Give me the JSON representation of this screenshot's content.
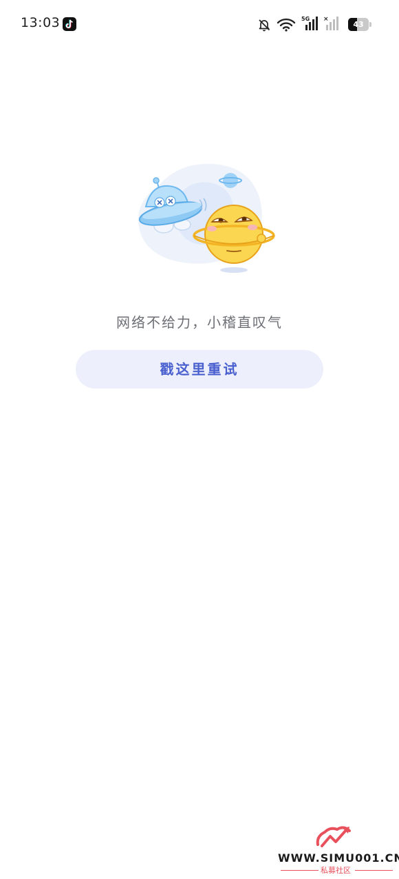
{
  "status_bar": {
    "time": "13:03",
    "app_icon": "tiktok-icon",
    "icons": [
      "bell-off-icon",
      "wifi-icon",
      "signal-5g-icon",
      "signal-icon"
    ],
    "signal_label": "5G",
    "battery_level": "43"
  },
  "illustration": {
    "name": "ufo-and-planet-illustration"
  },
  "error": {
    "message": "网络不给力，小稽直叹气",
    "retry_label": "戳这里重试"
  },
  "watermark": {
    "site": "WWW.SIMU001.CN",
    "subtitle": "私募社区"
  },
  "colors": {
    "accent": "#4b60cf",
    "button_bg": "#edf0fc",
    "text_secondary": "#6d6f75",
    "watermark_red": "#e8505b"
  }
}
